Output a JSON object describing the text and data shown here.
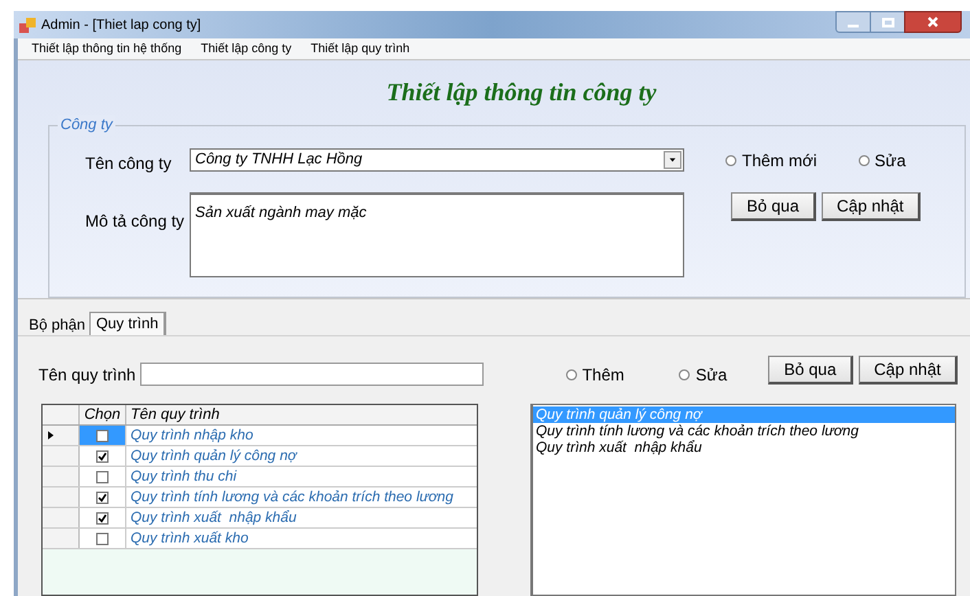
{
  "window": {
    "title": "Admin - [Thiet lap cong ty]"
  },
  "menu": [
    {
      "label": "Thiết lập thông tin hệ thống"
    },
    {
      "label": "Thiết lập công ty"
    },
    {
      "label": "Thiết lập quy trình"
    }
  ],
  "header": {
    "title": "Thiết lập thông tin công ty"
  },
  "company": {
    "legend": "Công ty",
    "name_label": "Tên công ty",
    "name_value": "Công ty TNHH Lạc Hồng",
    "description_label": "Mô tả công ty",
    "description_value": "Sản xuất ngành may mặc",
    "modes": [
      {
        "label": "Thêm mới",
        "selected": false
      },
      {
        "label": "Sửa",
        "selected": false
      }
    ],
    "buttons": [
      "Bỏ qua",
      "Cập nhật"
    ]
  },
  "tabs": [
    {
      "label": "Bộ phận",
      "selected": false
    },
    {
      "label": "Quy trình",
      "selected": true
    }
  ],
  "process": {
    "name_label": "Tên quy trình",
    "modes": [
      {
        "label": "Thêm",
        "selected": false
      },
      {
        "label": "Sửa",
        "selected": false
      }
    ],
    "buttons": [
      "Bỏ qua",
      "Cập nhật"
    ],
    "grid": {
      "columns": [
        "Chọn",
        "Tên quy trình"
      ],
      "rows": [
        {
          "checked": false,
          "name": "Quy trình nhập kho",
          "current": true
        },
        {
          "checked": true,
          "name": "Quy trình quản lý công nợ",
          "current": false
        },
        {
          "checked": false,
          "name": "Quy trình thu chi",
          "current": false
        },
        {
          "checked": true,
          "name": "Quy trình tính lương và các khoản trích theo lương",
          "current": false
        },
        {
          "checked": true,
          "name": "Quy trình xuất  nhập khẩu",
          "current": false
        },
        {
          "checked": false,
          "name": "Quy trình xuất kho",
          "current": false
        }
      ]
    },
    "list": [
      {
        "label": "Quy trình quản lý công nợ",
        "selected": true
      },
      {
        "label": "Quy trình tính lương và các khoản trích theo lương",
        "selected": false
      },
      {
        "label": "Quy trình xuất  nhập khẩu",
        "selected": false
      }
    ]
  }
}
